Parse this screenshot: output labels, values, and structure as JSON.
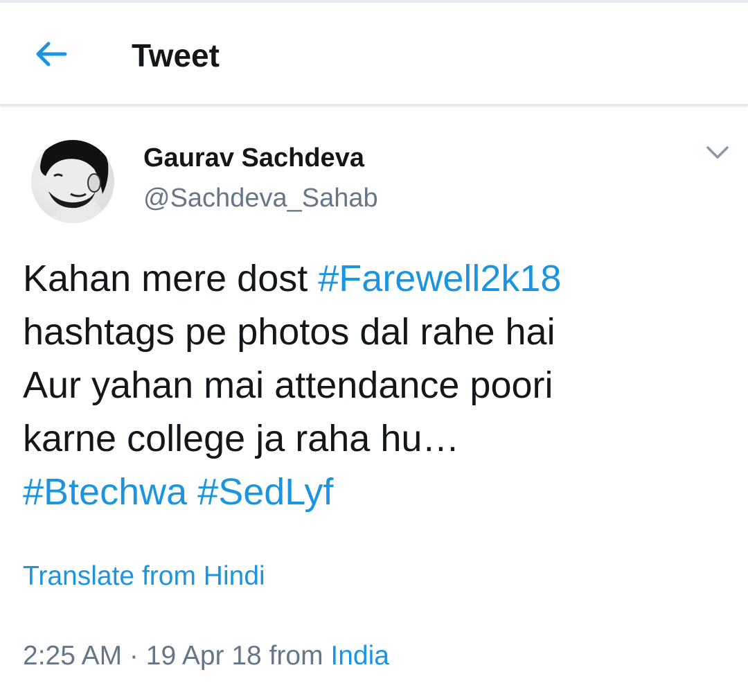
{
  "header": {
    "back_icon": "arrow-left-icon",
    "title": "Tweet"
  },
  "tweet": {
    "author": {
      "name": "Gaurav Sachdeva",
      "handle": "@Sachdeva_Sahab",
      "avatar": "profile-photo-grayscale"
    },
    "menu_icon": "chevron-down-icon",
    "text_lines": [
      [
        {
          "text": "Kahan mere dost ",
          "type": "text"
        },
        {
          "text": "#Farewell2k18",
          "type": "hashtag"
        }
      ],
      [
        {
          "text": "hashtags pe photos dal rahe hai",
          "type": "text"
        }
      ],
      [
        {
          "text": "Aur yahan mai attendance poori",
          "type": "text"
        }
      ],
      [
        {
          "text": "karne college ja raha hu…",
          "type": "text"
        }
      ],
      [
        {
          "text": "#Btechwa",
          "type": "hashtag"
        },
        {
          "text": " ",
          "type": "text"
        },
        {
          "text": "#SedLyf",
          "type": "hashtag"
        }
      ]
    ],
    "translate_label": "Translate from Hindi",
    "time": "2:25 AM",
    "separator": " · ",
    "date": "19 Apr 18",
    "from_label": " from ",
    "location": "India"
  },
  "colors": {
    "link": "#1b95e0",
    "text": "#14171a",
    "secondary": "#657786",
    "divider": "#e1e8ed"
  }
}
